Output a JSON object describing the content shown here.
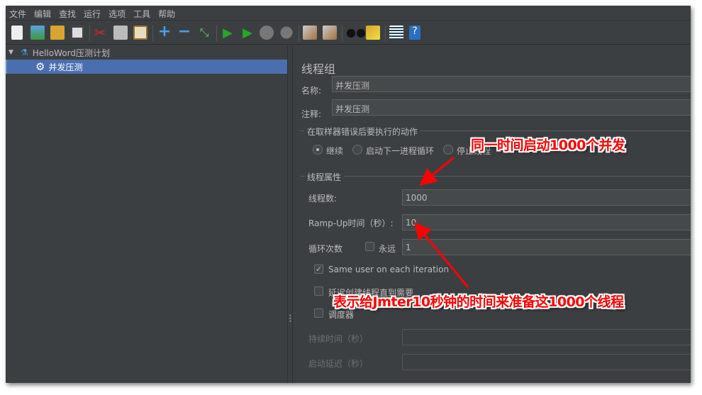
{
  "menu": [
    "文件",
    "编辑",
    "查找",
    "运行",
    "选项",
    "工具",
    "帮助"
  ],
  "toolbar_icons": [
    "new-icon",
    "templates-icon",
    "open-icon",
    "save-icon",
    "cut-icon",
    "copy-icon",
    "paste-icon",
    "expand-icon",
    "collapse-icon",
    "toggle-icon",
    "start-icon",
    "start-no-pause-icon",
    "stop-icon",
    "shutdown-icon",
    "clear-icon",
    "clear-all-icon",
    "search-icon",
    "reset-search-icon",
    "function-helper-icon",
    "help-icon"
  ],
  "tree": {
    "root": "HelloWord压测计划",
    "child": "并发压测"
  },
  "panel": {
    "title": "线程组",
    "name_label": "名称:",
    "name_value": "并发压测",
    "comment_label": "注释:",
    "comment_value": "并发压测",
    "error_group": "在取样器错误后要执行的动作",
    "radios": [
      "继续",
      "启动下一进程循环",
      "停止线程"
    ],
    "thread_group": "线程属性",
    "threads_label": "线程数:",
    "threads_value": "1000",
    "rampup_label": "Ramp-Up时间（秒）:",
    "rampup_value": "10",
    "loop_label": "循环次数",
    "forever_label": "永远",
    "loop_value": "1",
    "same_user_label": "Same user on each iteration",
    "same_user_checked": true,
    "delay_label": "延迟创建线程直到需要",
    "scheduler_label": "调度器",
    "duration_label": "持续时间（秒）",
    "startup_delay_label": "启动延迟（秒）"
  },
  "annotations": {
    "top": "同一时间启动1000个并发",
    "bottom": "表示给Jmter10秒钟的时间来准备这1000个线程",
    "color": "#ff0000"
  }
}
